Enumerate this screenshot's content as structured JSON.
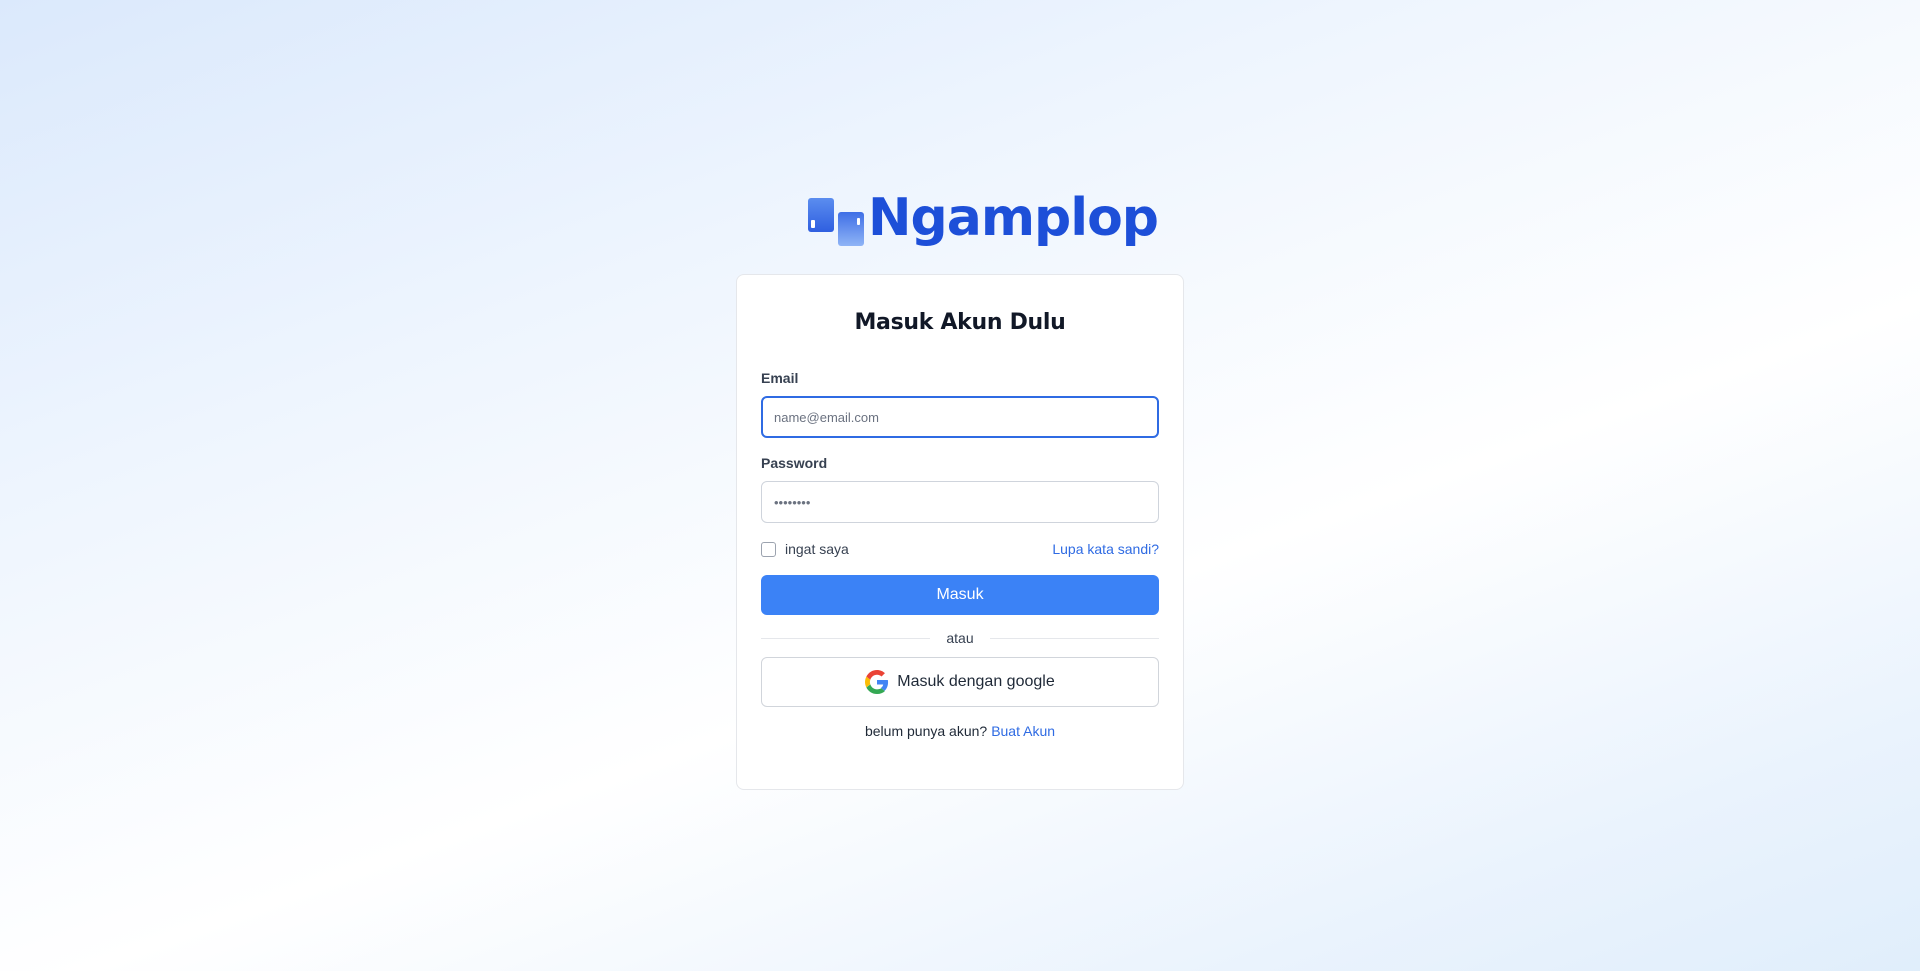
{
  "brand": {
    "name": "Ngamplop",
    "color": "#1d4fd8"
  },
  "login": {
    "title": "Masuk Akun Dulu",
    "email": {
      "label": "Email",
      "placeholder": "name@email.com",
      "value": ""
    },
    "password": {
      "label": "Password",
      "placeholder": "••••••••",
      "value": ""
    },
    "remember_label": "ingat saya",
    "remember_checked": false,
    "forgot_link": "Lupa kata sandi?",
    "submit_label": "Masuk",
    "divider_text": "atau",
    "google_label": "Masuk dengan google",
    "signup_prompt": "belum punya akun?",
    "signup_link": "Buat Akun"
  },
  "colors": {
    "primary": "#3b82f6",
    "link": "#2f6be3",
    "focus_border": "#2f6be3"
  },
  "icons": {
    "logo": "ngamplop-logo-icon",
    "google": "google-icon"
  }
}
